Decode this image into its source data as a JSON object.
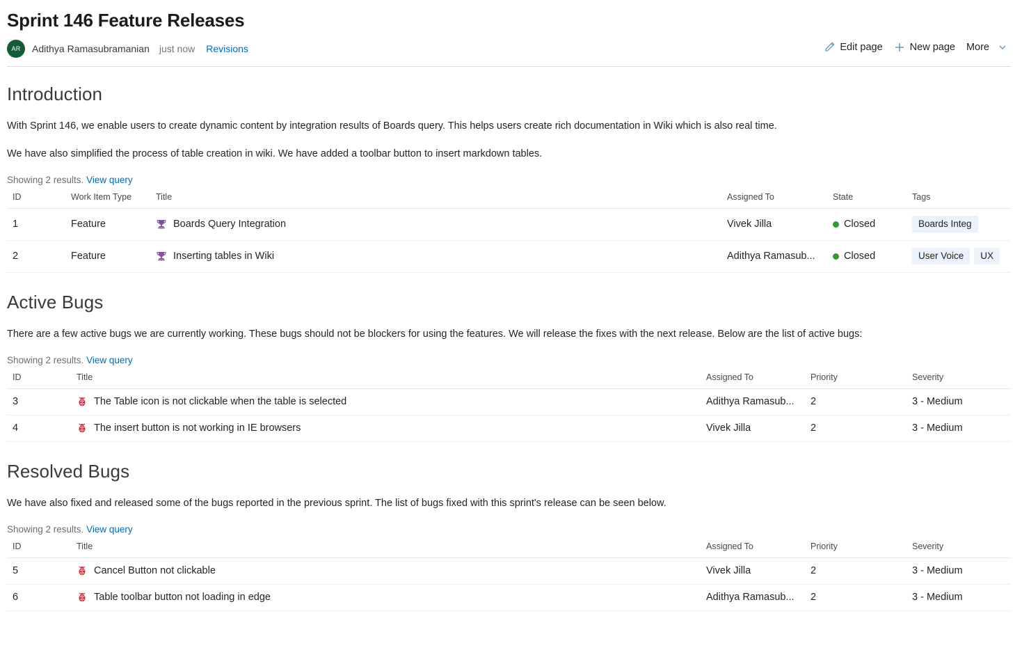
{
  "header": {
    "title": "Sprint 146 Feature Releases",
    "avatar_initials": "AR",
    "author": "Adithya Ramasubramanian",
    "timestamp": "just now",
    "revisions_label": "Revisions",
    "actions": {
      "edit_page": "Edit page",
      "new_page": "New page",
      "more": "More"
    }
  },
  "colors": {
    "link": "#0069c0",
    "avatar_bg": "#145c35",
    "state_closed_dot": "#339933",
    "feature_icon": "#8250a0",
    "bug_icon": "#cc293d",
    "tag_chip_bg": "#eaf3fb"
  },
  "sections": [
    {
      "title": "Introduction",
      "paragraphs": [
        "With Sprint 146, we enable users to create dynamic content by integration results of Boards query. This helps users create rich documentation in Wiki which is also real time.",
        "We have also simplified the process of table creation in wiki. We have added a toolbar button to insert markdown tables."
      ],
      "query": {
        "results_text": "Showing 2 results.",
        "view_query_label": "View query",
        "type": "features",
        "columns": [
          "ID",
          "Work Item Type",
          "Title",
          "Assigned To",
          "State",
          "Tags"
        ],
        "rows": [
          {
            "id": "1",
            "work_item_type": "Feature",
            "icon": "trophy-icon",
            "title": "Boards Query Integration",
            "assigned_to": "Vivek Jilla",
            "state": "Closed",
            "tags": [
              "Boards Integ"
            ]
          },
          {
            "id": "2",
            "work_item_type": "Feature",
            "icon": "trophy-icon",
            "title": "Inserting tables in Wiki",
            "assigned_to": "Adithya Ramasub...",
            "state": "Closed",
            "tags": [
              "User Voice",
              "UX"
            ]
          }
        ]
      }
    },
    {
      "title": "Active Bugs",
      "paragraphs": [
        "There are a few active bugs we are currently working. These bugs should not be blockers for using the features. We will release the fixes with the next release. Below are the list of active bugs:"
      ],
      "query": {
        "results_text": "Showing 2 results.",
        "view_query_label": "View query",
        "type": "bugs",
        "columns": [
          "ID",
          "Title",
          "Assigned To",
          "Priority",
          "Severity"
        ],
        "rows": [
          {
            "id": "3",
            "icon": "bug-icon",
            "title": "The Table icon is not clickable when the table is selected",
            "assigned_to": "Adithya Ramasub...",
            "priority": "2",
            "severity": "3 - Medium"
          },
          {
            "id": "4",
            "icon": "bug-icon",
            "title": "The insert button is not working in IE browsers",
            "assigned_to": "Vivek Jilla",
            "priority": "2",
            "severity": "3 - Medium"
          }
        ]
      }
    },
    {
      "title": "Resolved Bugs",
      "paragraphs": [
        "We have also fixed and released some of the bugs reported in the previous sprint. The list of bugs fixed with this sprint's release can be seen below."
      ],
      "query": {
        "results_text": "Showing 2 results.",
        "view_query_label": "View query",
        "type": "bugs",
        "columns": [
          "ID",
          "Title",
          "Assigned To",
          "Priority",
          "Severity"
        ],
        "rows": [
          {
            "id": "5",
            "icon": "bug-icon",
            "title": "Cancel Button not clickable",
            "assigned_to": "Vivek Jilla",
            "priority": "2",
            "severity": "3 - Medium"
          },
          {
            "id": "6",
            "icon": "bug-icon",
            "title": "Table toolbar button not loading in edge",
            "assigned_to": "Adithya Ramasub...",
            "priority": "2",
            "severity": "3 - Medium"
          }
        ]
      }
    }
  ]
}
